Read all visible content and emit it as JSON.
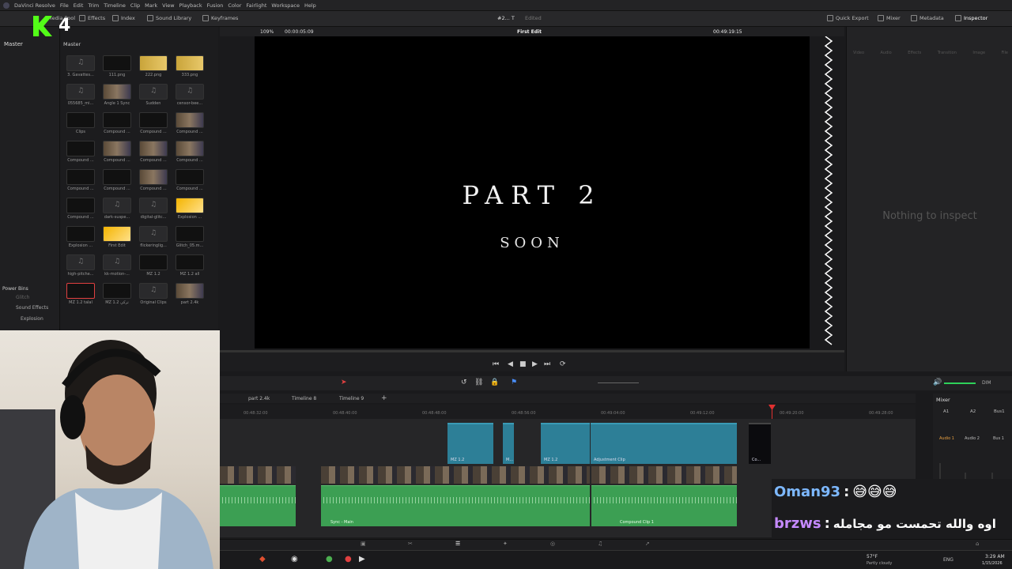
{
  "app": {
    "title": "DaVinci Resolve",
    "menu": [
      "DaVinci Resolve",
      "File",
      "Edit",
      "Trim",
      "Timeline",
      "Clip",
      "Mark",
      "View",
      "Playback",
      "Fusion",
      "Color",
      "Fairlight",
      "Workspace",
      "Help"
    ]
  },
  "toolbar": {
    "media_pool": "Media Pool",
    "effects": "Effects",
    "index": "Index",
    "sound_library": "Sound Library",
    "keyframes": "Keyframes",
    "project": "#2... T",
    "edited": "Edited",
    "quick_export": "Quick Export",
    "mixer": "Mixer",
    "metadata": "Metadata",
    "inspector": "Inspector"
  },
  "left_panel": {
    "master": "Master",
    "power_bins": "Power Bins",
    "glitch": "Glitch",
    "sound_effects": "Sound Effects",
    "explosion": "Explosion"
  },
  "media_pool": {
    "header": "Master",
    "items": [
      {
        "label": "3. Gavattes...",
        "kind": "audio"
      },
      {
        "label": "111.png",
        "kind": "dark"
      },
      {
        "label": "222.png",
        "kind": "gold"
      },
      {
        "label": "333.png",
        "kind": "gold"
      },
      {
        "label": "055685_mi...",
        "kind": "audio"
      },
      {
        "label": "Angle 1 Sync",
        "kind": "people"
      },
      {
        "label": "Sudden",
        "kind": "audio"
      },
      {
        "label": "censor-bee...",
        "kind": "audio"
      },
      {
        "label": "Clips",
        "kind": "dark"
      },
      {
        "label": "Compound ...",
        "kind": "dark"
      },
      {
        "label": "Compound ...",
        "kind": "dark"
      },
      {
        "label": "Compound ...",
        "kind": "people"
      },
      {
        "label": "Compound ...",
        "kind": "dark"
      },
      {
        "label": "Compound ...",
        "kind": "people"
      },
      {
        "label": "Compound ...",
        "kind": "people"
      },
      {
        "label": "Compound ...",
        "kind": "people"
      },
      {
        "label": "Compound ...",
        "kind": "dark"
      },
      {
        "label": "Compound ...",
        "kind": "dark"
      },
      {
        "label": "Compound ...",
        "kind": "people"
      },
      {
        "label": "Compound ...",
        "kind": "dark"
      },
      {
        "label": "Compound ...",
        "kind": "dark"
      },
      {
        "label": "dark-suspe...",
        "kind": "audio"
      },
      {
        "label": "digital-glitc...",
        "kind": "audio"
      },
      {
        "label": "Explosion ...",
        "kind": "orange"
      },
      {
        "label": "Explosion ...",
        "kind": "dark"
      },
      {
        "label": "First Edit",
        "kind": "orange"
      },
      {
        "label": "flickeringlig...",
        "kind": "audio"
      },
      {
        "label": "Glitch_05.m...",
        "kind": "dark"
      },
      {
        "label": "high-pitche...",
        "kind": "audio"
      },
      {
        "label": "kk-motion-...",
        "kind": "audio"
      },
      {
        "label": "MZ 1.2",
        "kind": "dark"
      },
      {
        "label": "MZ 1.2 all",
        "kind": "dark"
      },
      {
        "label": "MZ 1.2 talal",
        "kind": "selected"
      },
      {
        "label": "MZ 1.2 تركي",
        "kind": "dark"
      },
      {
        "label": "Original Clips",
        "kind": "audio"
      },
      {
        "label": "part 2.4k",
        "kind": "people"
      }
    ]
  },
  "viewer": {
    "zoom": "109%",
    "timecode_left": "00:00:05:09",
    "timeline_name": "First Edit",
    "timecode_right": "00:49:19:15",
    "title_text": "PART 2",
    "subtitle_text": "SOON"
  },
  "inspector": {
    "empty_text": "Nothing to inspect",
    "tabs": [
      "Video",
      "Audio",
      "Effects",
      "Transition",
      "Image",
      "File"
    ]
  },
  "timeline": {
    "tabs": [
      "part 2.4k",
      "Timeline 8",
      "Timeline 9"
    ],
    "ruler": [
      "00:48:32:00",
      "00:48:40:00",
      "00:48:48:00",
      "00:48:56:00",
      "00:49:04:00",
      "00:49:12:00",
      "00:49:20:00",
      "00:49:28:00"
    ],
    "clips": {
      "mz1": "MZ 1.2",
      "m": "M...",
      "mz2": "MZ 1.2",
      "adjust": "Adjustment Clip",
      "co": "Co...",
      "sync": "Sync - Main",
      "compound": "Compound Clip 1"
    }
  },
  "mixer": {
    "title": "Mixer",
    "channels": [
      "A1",
      "A2",
      "Bus1"
    ],
    "audio1": "Audio 1",
    "audio2": "Audio 2",
    "bus1": "Bus 1",
    "dim": "DIM"
  },
  "overlay": {
    "logo_text": "4",
    "chat": [
      {
        "user": "Oman93",
        "sep": ":",
        "msg": "😅😅😅",
        "user_color": "#7db8ff"
      },
      {
        "user": "brzws",
        "sep": ":",
        "msg": "اوه والله تحمست مو مجامله",
        "user_color": "#c58aff"
      }
    ]
  },
  "taskbar": {
    "weather_temp": "57°F",
    "weather_desc": "Partly cloudy",
    "lang": "ENG",
    "time": "3:29 AM",
    "date": "1/15/2026"
  }
}
